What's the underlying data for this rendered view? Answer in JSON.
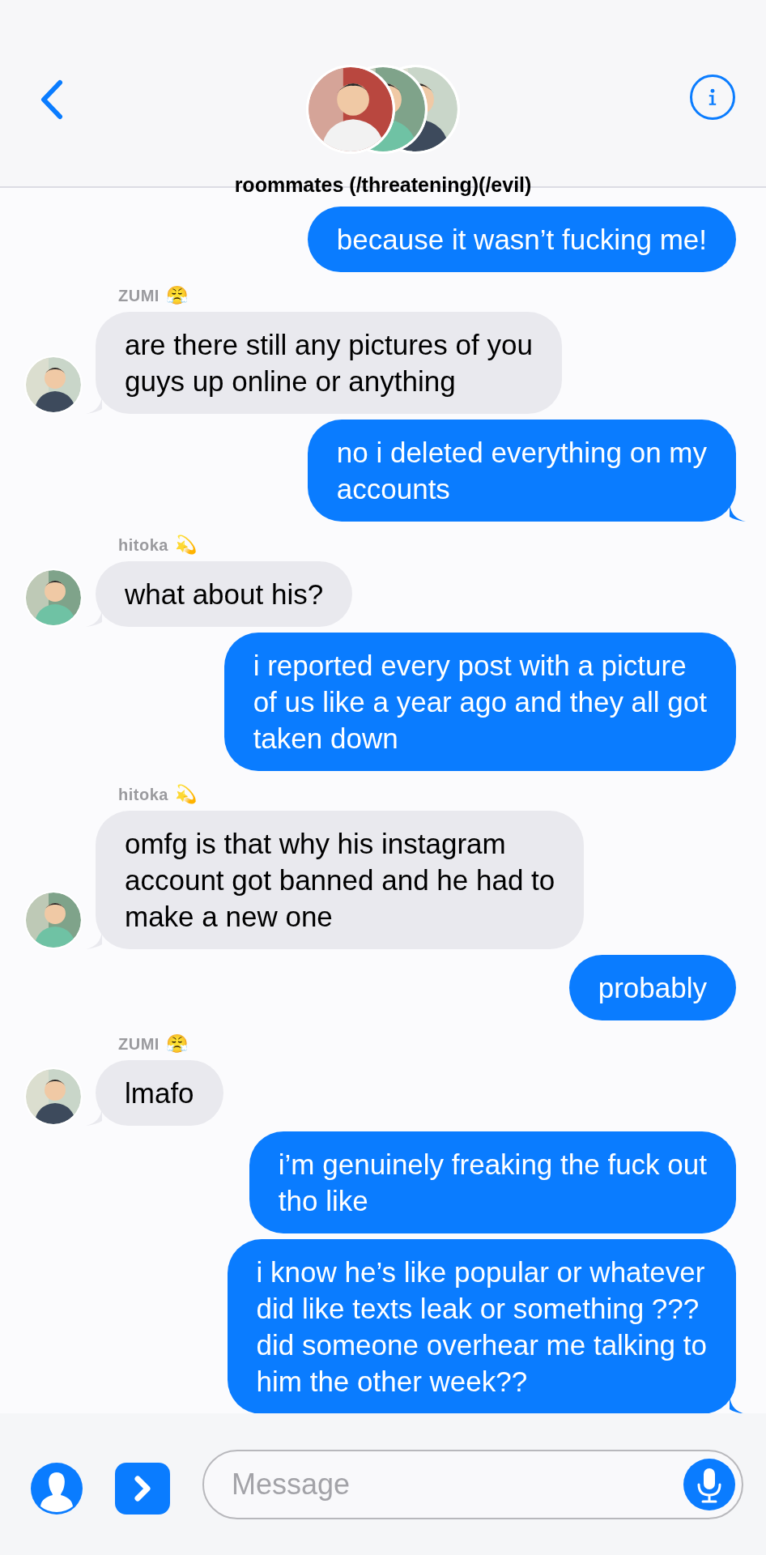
{
  "header": {
    "title": "roommates (/threatening)(/evil)"
  },
  "messages": [
    {
      "kind": "outgoing",
      "text": "because it wasn’t fucking me!",
      "tail": false
    },
    {
      "kind": "incoming",
      "sender": "ZUMI",
      "emoji": "😤",
      "text": "are there still any pictures of you\nguys up online or anything"
    },
    {
      "kind": "outgoing",
      "text": "no i deleted everything on my\naccounts",
      "tail": true
    },
    {
      "kind": "incoming",
      "sender": "hitoka",
      "emoji": "💫",
      "text": "what about his?"
    },
    {
      "kind": "outgoing",
      "text": "i reported every post with a picture\nof us like a year ago and they all got\ntaken down",
      "tail": false
    },
    {
      "kind": "incoming",
      "sender": "hitoka",
      "emoji": "💫",
      "text": "omfg is that why his instagram\naccount got banned and he had to\nmake a new one"
    },
    {
      "kind": "outgoing",
      "text": "probably",
      "tail": false
    },
    {
      "kind": "incoming",
      "sender": "ZUMI",
      "emoji": "😤",
      "text": "lmafo"
    },
    {
      "kind": "outgoing",
      "text": "i’m genuinely freaking the fuck out\ntho like",
      "tail": false
    },
    {
      "kind": "outgoing",
      "text": "i know he’s like popular or whatever\ndid like texts leak or something ???\ndid someone overhear me talking to\nhim the other week??",
      "tail": true
    }
  ],
  "composer": {
    "placeholder": "Message"
  }
}
